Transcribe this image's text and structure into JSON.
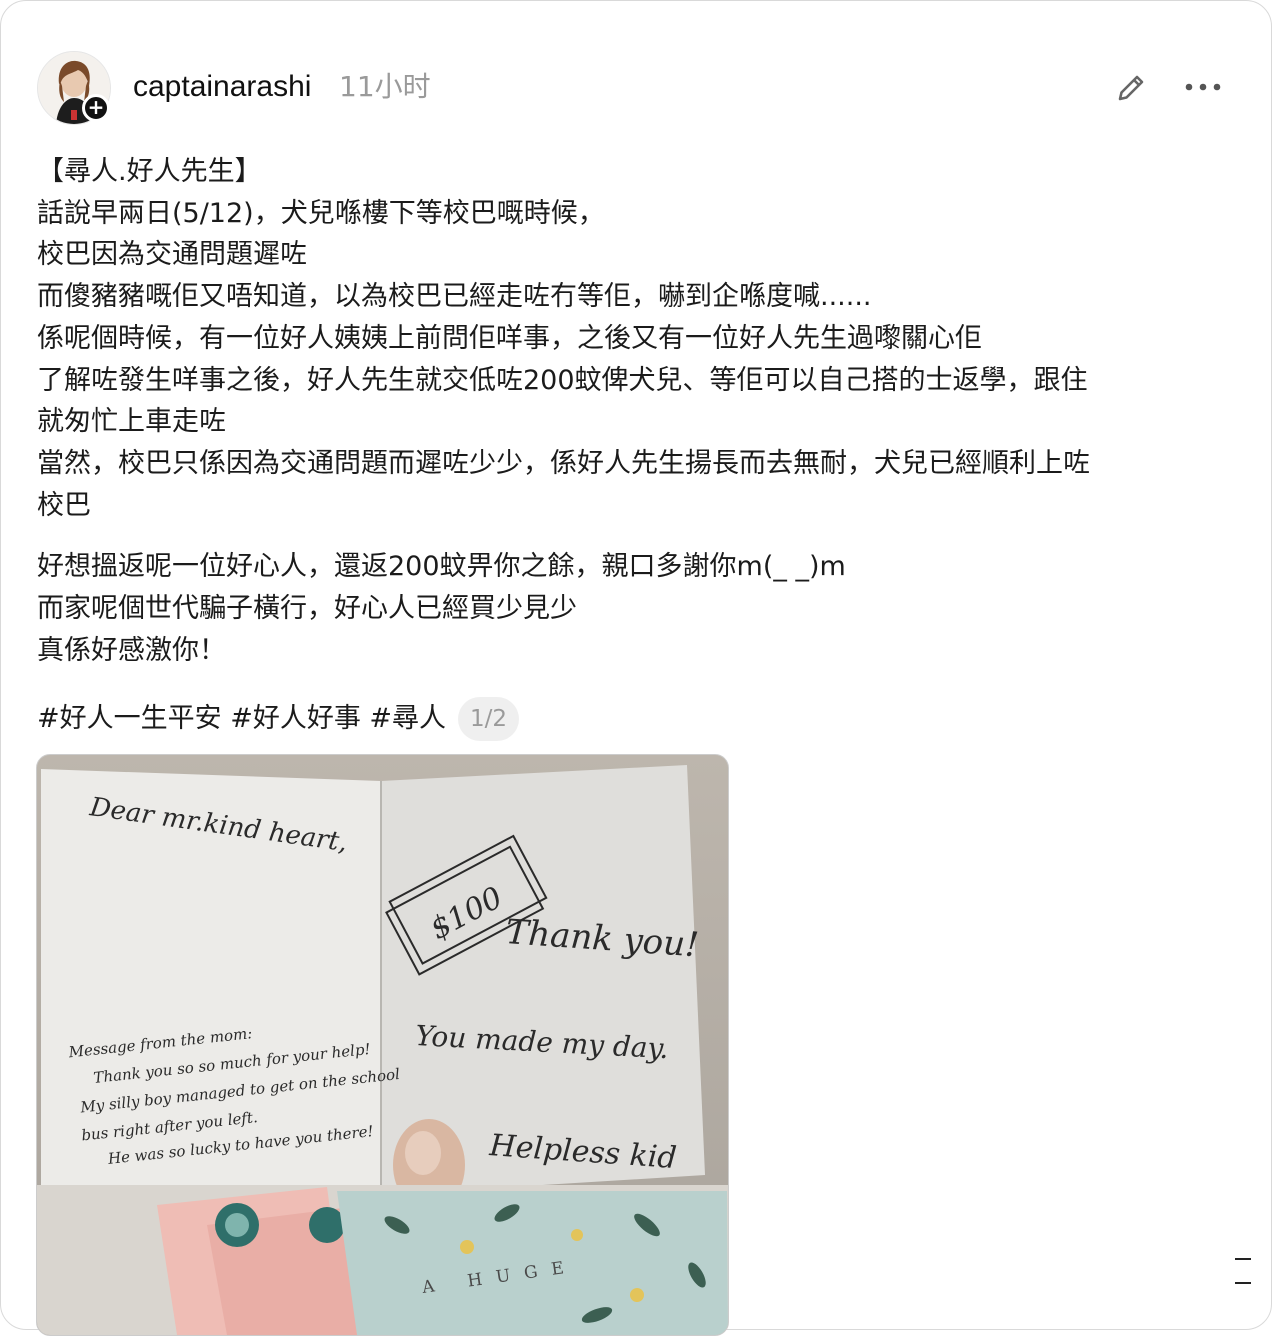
{
  "post": {
    "username": "captainarashi",
    "time": "11小时",
    "paragraphs": [
      [
        "【尋人.好人先生】",
        "話說早兩日(5/12)，犬兒喺樓下等校巴嘅時候，",
        "校巴因為交通問題遲咗",
        "而傻豬豬嘅佢又唔知道，以為校巴已經走咗冇等佢，嚇到企喺度喊......",
        "係呢個時候，有一位好人姨姨上前問佢咩事，之後又有一位好人先生過嚟關心佢",
        "了解咗發生咩事之後，好人先生就交低咗200蚊俾犬兒、等佢可以自己搭的士返學，跟住",
        "就匆忙上車走咗",
        "當然，校巴只係因為交通問題而遲咗少少，係好人先生揚長而去無耐，犬兒已經順利上咗",
        "校巴"
      ],
      [
        "好想搵返呢一位好心人，還返200蚊畀你之餘，親口多謝你m(_ _)m",
        "而家呢個世代騙子橫行，好心人已經買少見少",
        "真係好感激你！"
      ]
    ],
    "tags": "#好人一生平安 #好人好事 #尋人",
    "page_indicator": "1/2"
  },
  "media": {
    "card_handwriting": {
      "greeting": "Dear mr.kind heart,",
      "money_label": "$100",
      "thanks": "Thank you!",
      "day": "You made my day.",
      "signoff": "Helpless kid",
      "mom_note": [
        "Message from the mom:",
        "Thank you so so much for your help!",
        "My silly boy managed to get on the school",
        "bus right after you left.",
        "He was so lucky to have you there!"
      ]
    },
    "second_card_text": "A HUGE"
  },
  "icons": {
    "edit": "pencil-icon",
    "more": "more-dots-icon",
    "follow": "plus-icon"
  }
}
